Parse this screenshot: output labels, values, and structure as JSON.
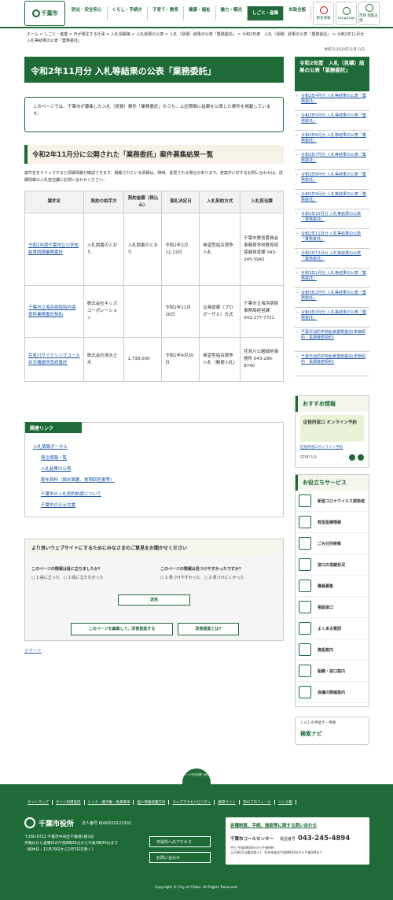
{
  "header": {
    "logo": "千葉市",
    "nav": [
      "防災・安全安心",
      "くらし・手続き",
      "子育て・教育",
      "健康・福祉",
      "魅力・観光",
      "しごと・産業",
      "市政全般"
    ],
    "btns": [
      "緊急情報",
      "Language",
      "市政 閲覧支援"
    ]
  },
  "breadcrumb": "ホーム > しごと・産業 > 市が発注する仕事 > 入札情報等 > 入札結果の公表 > 入札（見積）結果の公表「業務委託」 > 令和2年度　入札（見積）結果の公表「業務委託」 > 令和2年11月分 入札等結果の公表「業務委託」",
  "updated": "更新日:2020年11月11日",
  "page_title": "令和2年11月分 入札等結果の公表「業務委託」",
  "intro": "このページでは、千葉市が募集した入札（見積）案件「業務委託」のうち、上記期間に結果を公表した案件を掲載しています。",
  "section_title": "令和2年11月分に公開された「業務委託」案件募集結果一覧",
  "note": "案件名をクリックすると詳細情報が確認できます。掲載されている情報は、随時、変更される場合があります。各案件に対するお問い合わせは、詳細情報の入札担当課にお問い合わせください。",
  "table": {
    "headers": [
      "案件名",
      "契約の相手方",
      "契約金額（税込み）",
      "落札決定日",
      "入札契約方式",
      "入札担当課"
    ],
    "rows": [
      [
        "令和2年度千葉市立小学校給食調理業務委託",
        "入札調書のとおり",
        "入札調書のとおり",
        "令和2年2月12,13日",
        "希望型指名競争入札",
        "千葉市教育委員会事務局学校教育部保健体育課 043-245-5942"
      ],
      [
        "千葉市立海浜病院院内保育所業務委託契約",
        "株式会社キッズコーポレーション",
        "",
        "令和2年11月26日",
        "企画提案（プロポーザル）方式",
        "千葉市立海浜病院事務局経営課 043-277-7711"
      ],
      [
        "花見川サイクリングコース弁天橋便所改修委託",
        "株式会社清水土木",
        "1,738,000",
        "令和2年6月30日",
        "希望型指名競争入札（郵便入札）",
        "花見川公園緑地事務所 043-286-8740"
      ]
    ]
  },
  "side": {
    "title": "令和2年度　入札（見積）結果の公表「業務委託」",
    "items": [
      "令和2年4月分 入札等結果の公表「業務委託」",
      "令和2年5月分 入札等結果の公表「業務委託」",
      "令和2年6月分 入札等結果の公表「業務委託」",
      "令和2年7月分 入札等結果の公表「業務委託」",
      "令和2年8月分 入札等結果の公表「業務委託」",
      "令和2年9月分 入札等結果の公表「業務委託」",
      "令和2年10月分 入札等結果の公表「業務委託」",
      "令和2年11月分 入札等結果の公表「業務委託」",
      "令和2年12月分 入札等結果の公表「業務委託」",
      "令和3年1月分 入札等結果の公表「業務委託」",
      "令和3年2月分 入札等結果の公表「業務委託」",
      "令和3年3月分 入札等結果の公表「業務委託」",
      "千葉市消防学校給食業務委託(単価契約・長期継続契約)",
      "千葉市消防学校給食業務委託(単価契約・長期継続契約)"
    ]
  },
  "recommend": {
    "title": "おすすめ情報",
    "banner": "区役所窓口 オンライン予約",
    "link": "区役所窓口オンライン予約",
    "stop": "STOP",
    "page": "1/3"
  },
  "services": {
    "title": "お役立ちサービス",
    "items": [
      "新型コロナウイルス感染症",
      "救急医療情報",
      "ごみ分別検索",
      "窓口の混雑状況",
      "職員募集",
      "相談窓口",
      "よくある質問",
      "施設案内",
      "組織・窓口案内",
      "会議の開催案内"
    ]
  },
  "navi": {
    "sub": "くらしの手続き・申請",
    "title": "検索ナビ"
  },
  "related": {
    "title": "関連リンク",
    "items": [
      "入札情報ポータル",
      "発注情報一覧",
      "入札結果の公表",
      "配布資料（設計図書、質問回答書等）",
      "千葉市の入札契約制度について",
      "千葉市の公示文書"
    ]
  },
  "feedback": {
    "title": "より良いウェブサイトにするためにみなさまのご意見をお聞かせください",
    "q1": "このページの情報は役に立ちましたか？",
    "q1o": "○ 1:役に立った　○ 2:役に立たなかった",
    "q2": "このページの情報は見つけやすかったですか？",
    "q2o": "○ 1:見つけやすかった　○ 2:見つけにくかった",
    "send": "送信",
    "edit": "このページを編集して、改善提案する",
    "what": "改善提案とは?"
  },
  "tweet": "ツイート",
  "pagetop": "ページの先頭へ戻る",
  "footer": {
    "links": [
      "サイトマップ",
      "サイト利用案内",
      "リンク・著作権・免責事項",
      "個人情報保護方針",
      "ウェブアクセシビリティ",
      "携帯サイト",
      "市のプロフィール",
      "リンク集"
    ],
    "name": "千葉市役所",
    "corp": "法人番号 6000020121002",
    "addr1": "〒260-8722 千葉市中央区千葉港1番1号",
    "addr2": "月曜日から金曜日の午前8時30分から午後5時30分まで",
    "addr3": "（祝休日・12月29日から1月3日を除く）",
    "access": "市役所へのアクセス",
    "contact": "お問い合わせ",
    "cc_title": "各種制度、手続、施設等に関する問い合わせ",
    "cc_name": "千葉市コールセンター",
    "cc_tel_label": "電話番号",
    "cc_tel": "043-245-4894",
    "cc_h1": "平日 午前8時30分から午後9時",
    "cc_h2": "土日休日(日曜は除く)、年末年始は午前8時30分から午後5時まで",
    "copyright": "Copyright © City of Chiba. All Rights Reserved."
  }
}
